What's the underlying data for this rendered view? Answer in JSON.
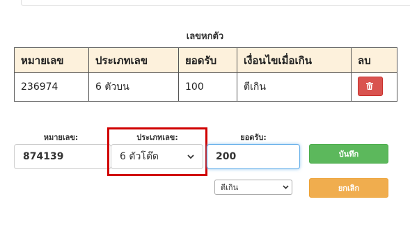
{
  "table": {
    "title": "เลขหกตัว",
    "headers": [
      "หมายเลข",
      "ประเภทเลข",
      "ยอดรับ",
      "เงื่อนไขเมื่อเกิน",
      "ลบ"
    ],
    "rows": [
      {
        "number": "236974",
        "type": "6 ตัวบน",
        "amount": "100",
        "condition": "ตีเกิน",
        "delete_icon": "trash-icon"
      }
    ]
  },
  "form": {
    "number_label": "หมายเลข:",
    "number_value": "874139",
    "type_label": "ประเภทเลข:",
    "type_value": "6 ตัวโต๊ด",
    "amount_label": "ยอดรับ:",
    "amount_value": "200",
    "condition_value": "ตีเกิน",
    "save_label": "บันทึก",
    "cancel_label": "ยกเลิก"
  },
  "colors": {
    "header_bg": "#fdf1dc",
    "delete_button": "#d9534f",
    "save_button": "#5cb85c",
    "cancel_button": "#f0ad4e",
    "highlight_box": "#d00000",
    "focus_border": "#66afe9"
  }
}
